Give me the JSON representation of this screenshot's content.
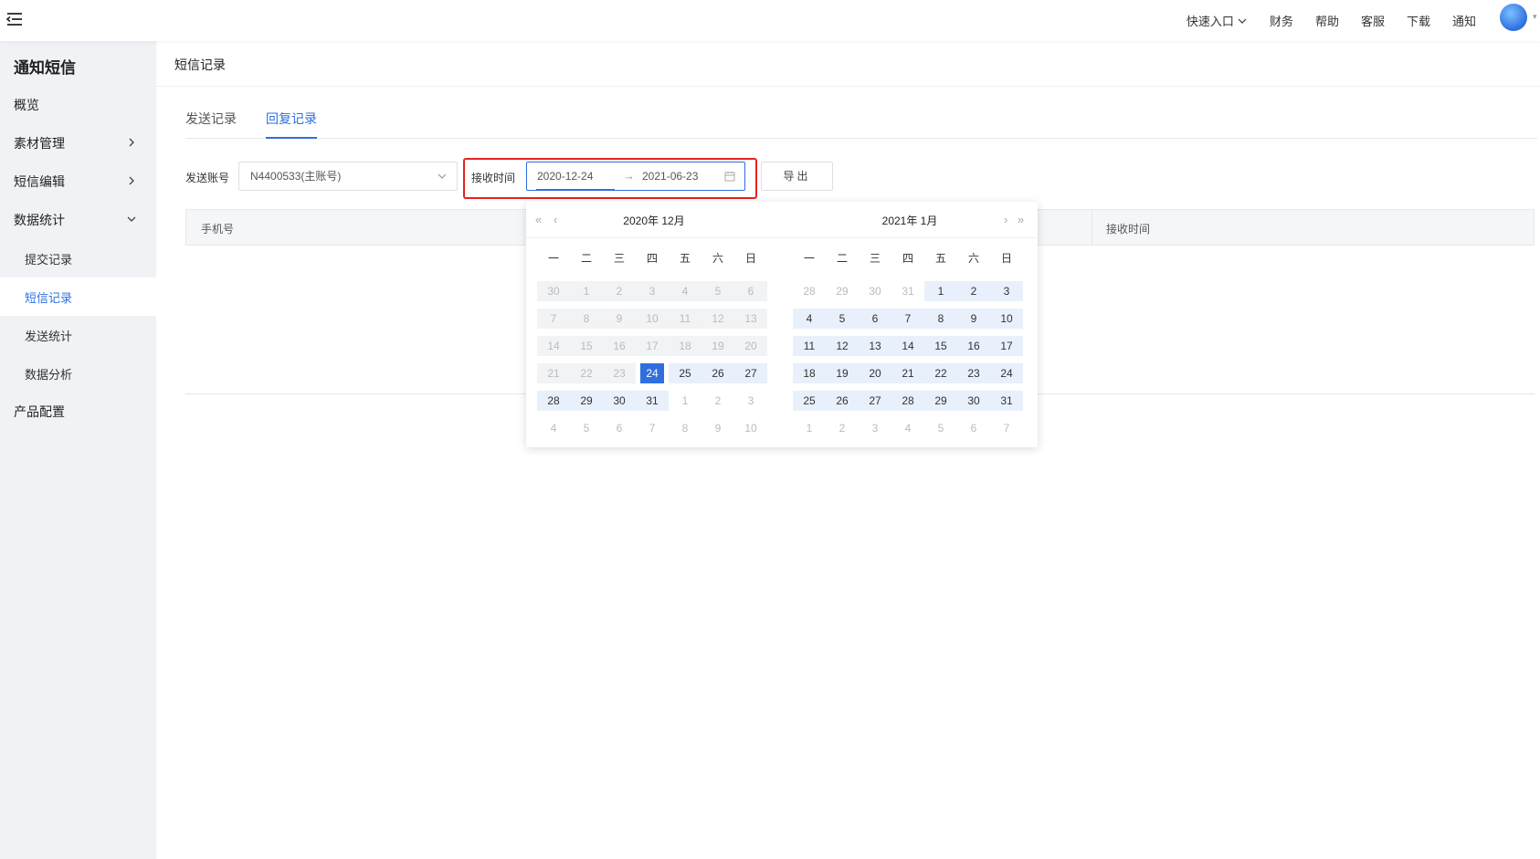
{
  "topbar": {
    "menu_icon": "menu-collapse-icon",
    "nav": [
      {
        "label": "快速入口",
        "has_caret": true
      },
      {
        "label": "财务"
      },
      {
        "label": "帮助"
      },
      {
        "label": "客服"
      },
      {
        "label": "下载"
      },
      {
        "label": "通知"
      }
    ]
  },
  "sidebar": {
    "title": "通知短信",
    "items": [
      {
        "label": "概览"
      },
      {
        "label": "素材管理",
        "chevron": "right"
      },
      {
        "label": "短信编辑",
        "chevron": "right"
      },
      {
        "label": "数据统计",
        "chevron": "down"
      }
    ],
    "subitems": [
      {
        "label": "提交记录"
      },
      {
        "label": "短信记录",
        "active": true
      },
      {
        "label": "发送统计"
      },
      {
        "label": "数据分析"
      }
    ],
    "bottom_item": "产品配置"
  },
  "breadcrumb": "短信记录",
  "tabs": [
    {
      "label": "发送记录",
      "active": false
    },
    {
      "label": "回复记录",
      "active": true
    }
  ],
  "filters": {
    "account_label": "发送账号",
    "account_value": "N4400533(主账号)",
    "time_label": "接收时间",
    "start_date": "2020-12-24",
    "arrow": "→",
    "end_date": "2021-06-23",
    "export_label": "导出"
  },
  "table": {
    "columns": [
      "手机号",
      "接收时间"
    ]
  },
  "calendar": {
    "left_title": "2020年  12月",
    "right_title": "2021年  1月",
    "weekdays": [
      "一",
      "二",
      "三",
      "四",
      "五",
      "六",
      "日"
    ],
    "left_days": [
      [
        "30",
        "m"
      ],
      [
        "1",
        "m"
      ],
      [
        "2",
        "m"
      ],
      [
        "3",
        "m"
      ],
      [
        "4",
        "m"
      ],
      [
        "5",
        "m"
      ],
      [
        "6",
        "m"
      ],
      [
        "7",
        "m"
      ],
      [
        "8",
        "m"
      ],
      [
        "9",
        "m"
      ],
      [
        "10",
        "m"
      ],
      [
        "11",
        "m"
      ],
      [
        "12",
        "m"
      ],
      [
        "13",
        "m"
      ],
      [
        "14",
        "m"
      ],
      [
        "15",
        "m"
      ],
      [
        "16",
        "m"
      ],
      [
        "17",
        "m"
      ],
      [
        "18",
        "m"
      ],
      [
        "19",
        "m"
      ],
      [
        "20",
        "m"
      ],
      [
        "21",
        "m"
      ],
      [
        "22",
        "m"
      ],
      [
        "23",
        "m"
      ],
      [
        "24",
        "s"
      ],
      [
        "25",
        "r"
      ],
      [
        "26",
        "r"
      ],
      [
        "27",
        "r"
      ],
      [
        "28",
        "r"
      ],
      [
        "29",
        "r"
      ],
      [
        "30",
        "r"
      ],
      [
        "31",
        "r"
      ],
      [
        "1",
        "n"
      ],
      [
        "2",
        "n"
      ],
      [
        "3",
        "n"
      ],
      [
        "4",
        "n"
      ],
      [
        "5",
        "n"
      ],
      [
        "6",
        "n"
      ],
      [
        "7",
        "n"
      ],
      [
        "8",
        "n"
      ],
      [
        "9",
        "n"
      ],
      [
        "10",
        "n"
      ]
    ],
    "right_days": [
      [
        "28",
        "n"
      ],
      [
        "29",
        "n"
      ],
      [
        "30",
        "n"
      ],
      [
        "31",
        "n"
      ],
      [
        "1",
        "r"
      ],
      [
        "2",
        "r"
      ],
      [
        "3",
        "r"
      ],
      [
        "4",
        "r"
      ],
      [
        "5",
        "r"
      ],
      [
        "6",
        "r"
      ],
      [
        "7",
        "r"
      ],
      [
        "8",
        "r"
      ],
      [
        "9",
        "r"
      ],
      [
        "10",
        "r"
      ],
      [
        "11",
        "r"
      ],
      [
        "12",
        "r"
      ],
      [
        "13",
        "r"
      ],
      [
        "14",
        "r"
      ],
      [
        "15",
        "r"
      ],
      [
        "16",
        "r"
      ],
      [
        "17",
        "r"
      ],
      [
        "18",
        "r"
      ],
      [
        "19",
        "r"
      ],
      [
        "20",
        "r"
      ],
      [
        "21",
        "r"
      ],
      [
        "22",
        "r"
      ],
      [
        "23",
        "r"
      ],
      [
        "24",
        "r"
      ],
      [
        "25",
        "r"
      ],
      [
        "26",
        "r"
      ],
      [
        "27",
        "r"
      ],
      [
        "28",
        "r"
      ],
      [
        "29",
        "r"
      ],
      [
        "30",
        "r"
      ],
      [
        "31",
        "r"
      ],
      [
        "1",
        "n"
      ],
      [
        "2",
        "n"
      ],
      [
        "3",
        "n"
      ],
      [
        "4",
        "n"
      ],
      [
        "5",
        "n"
      ],
      [
        "6",
        "n"
      ],
      [
        "7",
        "n"
      ]
    ],
    "colors": {
      "accent": "#2f6fe0",
      "range": "#e8f0fc",
      "disabled": "#f2f3f5",
      "highlight": "#e52222"
    }
  }
}
